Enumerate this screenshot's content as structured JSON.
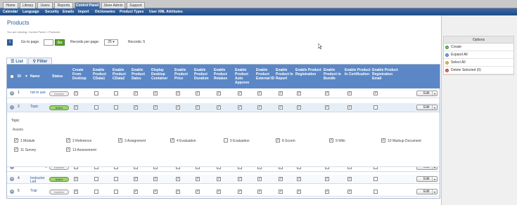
{
  "top_tabs": [
    "Home",
    "Library",
    "Users",
    "Reports",
    "Control Panel",
    "Store Admin",
    "Support"
  ],
  "active_top_tab": "Control Panel",
  "sub_nav": [
    "Calendar",
    "Language",
    "Security",
    "Emails",
    "Import",
    "Dictionaries",
    "Product Types",
    "User XML Attributes"
  ],
  "page": {
    "title": "Products",
    "breadcrumb": "You are viewing: Control Panel > Products"
  },
  "toolbar": {
    "go_to_page": "Go to page:",
    "go": "Go",
    "records_per_page": "Records per page:",
    "per_page_value": "25",
    "records": "Records: 5",
    "page_value": "1"
  },
  "view_tabs": {
    "list": "List",
    "filter": "Filter"
  },
  "columns": [
    "ID",
    "Name",
    "Status",
    "Create From Desktop",
    "Enable Product CData1",
    "Enable Product CData2",
    "Enable Product Dates",
    "Display Desktop Container",
    "Enable Product Price",
    "Enable Product Duration",
    "Enable Product Retakes",
    "Enable Product Auto Approve",
    "Enable Product External ID",
    "Enable Product In Report",
    "Enable Product Registration",
    "Enable Product in Bundle",
    "Enable Product In Certification",
    "Enable Product Registration Email"
  ],
  "rows": [
    {
      "id": "1",
      "name": "not in use",
      "status": "Inactive",
      "checks": [
        true,
        false,
        false,
        true,
        true,
        true,
        true,
        true,
        true,
        true,
        true,
        true,
        true,
        true,
        true
      ],
      "edit": "Edit"
    },
    {
      "id": "2",
      "name": "Topic",
      "status": "Active",
      "checks": [
        true,
        false,
        false,
        true,
        true,
        true,
        true,
        true,
        true,
        true,
        true,
        true,
        true,
        true,
        false
      ],
      "edit": "Edit"
    },
    {
      "id": "3",
      "name": "Job Listing",
      "status": "Inactive",
      "checks": [
        true,
        false,
        false,
        true,
        true,
        true,
        true,
        true,
        true,
        true,
        true,
        true,
        true,
        true,
        false
      ],
      "edit": "Edit"
    },
    {
      "id": "4",
      "name": "Instructor Led",
      "status": "Active",
      "checks": [
        true,
        false,
        false,
        true,
        true,
        true,
        true,
        true,
        true,
        true,
        true,
        true,
        true,
        true,
        false
      ],
      "edit": "Edit"
    },
    {
      "id": "5",
      "name": "Trial",
      "status": "Inactive",
      "checks": [
        true,
        false,
        false,
        true,
        true,
        true,
        true,
        true,
        true,
        true,
        true,
        true,
        true,
        true,
        false
      ],
      "edit": "Edit"
    }
  ],
  "detail": {
    "title": "Topic",
    "assets_label": "Assets",
    "assets": [
      {
        "label": "1 Module",
        "checked": true
      },
      {
        "label": "2 Reference",
        "checked": true
      },
      {
        "label": "3 Assignment",
        "checked": true
      },
      {
        "label": "4 Evaluation",
        "checked": true
      },
      {
        "label": "5 Evaluation",
        "checked": false
      },
      {
        "label": "8 Scorm",
        "checked": true
      },
      {
        "label": "9 Wiki",
        "checked": true
      },
      {
        "label": "10 Markup Document",
        "checked": true
      },
      {
        "label": "11 Survey",
        "checked": true
      },
      {
        "label": "13 Assessment",
        "checked": true
      }
    ]
  },
  "options": {
    "title": "Options",
    "items": [
      {
        "label": "Create",
        "icon": "plus-icon",
        "color": "#3c9a3c"
      },
      {
        "label": "Expand All",
        "icon": "expand-icon",
        "color": "#4a7ab5"
      },
      {
        "label": "Select All",
        "icon": "check-icon",
        "color": "#c8a030"
      },
      {
        "label": "Delete Selected (0)",
        "icon": "delete-icon",
        "color": "#c0392b"
      }
    ]
  },
  "colors": {
    "accent": "#2d5a95",
    "header": "#5b87c6",
    "active_tab": "#2d5a95",
    "go_button": "#5aa02c"
  }
}
